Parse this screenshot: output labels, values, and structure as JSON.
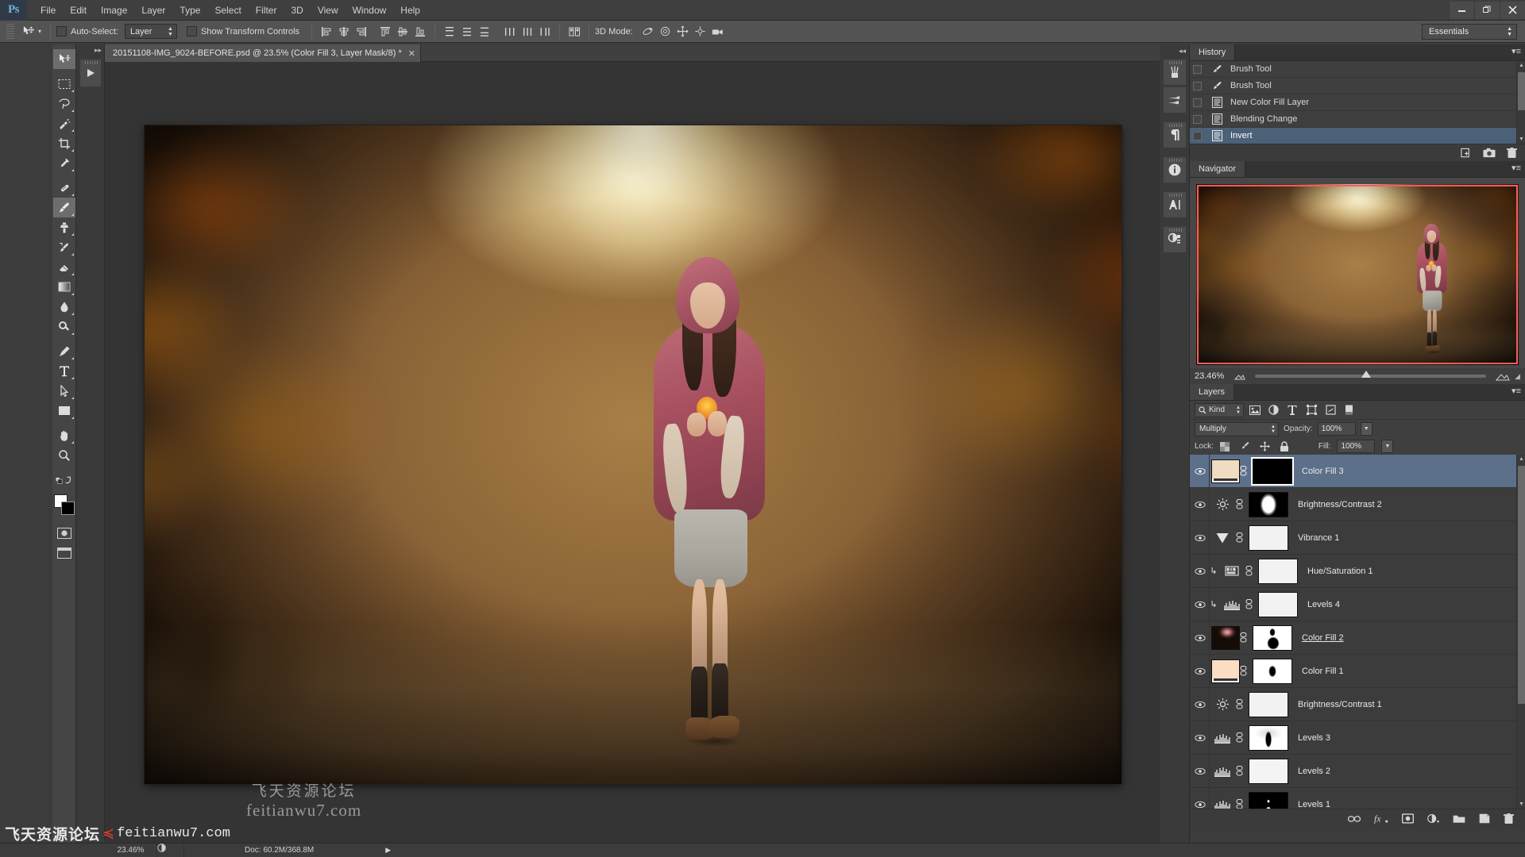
{
  "app": {
    "logo": "Ps"
  },
  "menubar": {
    "items": [
      "File",
      "Edit",
      "Image",
      "Layer",
      "Type",
      "Select",
      "Filter",
      "3D",
      "View",
      "Window",
      "Help"
    ],
    "window_controls": {
      "minimize": "—",
      "restore": "❐",
      "close": "✕"
    }
  },
  "options_bar": {
    "auto_select_label": "Auto-Select:",
    "auto_select_value": "Layer",
    "show_transform_label": "Show Transform Controls",
    "mode_3d_label": "3D Mode:",
    "workspace": "Essentials"
  },
  "toolbar": {
    "tools": [
      {
        "name": "move-tool",
        "glyph": "move",
        "active": false
      },
      {
        "name": "rectangular-marquee-tool",
        "glyph": "marquee",
        "active": false
      },
      {
        "name": "lasso-tool",
        "glyph": "lasso",
        "active": false
      },
      {
        "name": "quick-selection-tool",
        "glyph": "quickselect",
        "active": false
      },
      {
        "name": "crop-tool",
        "glyph": "crop",
        "active": false
      },
      {
        "name": "eyedropper-tool",
        "glyph": "eyedropper",
        "active": false
      },
      {
        "name": "spot-healing-brush-tool",
        "glyph": "healing",
        "active": false
      },
      {
        "name": "brush-tool",
        "glyph": "brush",
        "active": true
      },
      {
        "name": "clone-stamp-tool",
        "glyph": "stamp",
        "active": false
      },
      {
        "name": "history-brush-tool",
        "glyph": "historybrush",
        "active": false
      },
      {
        "name": "eraser-tool",
        "glyph": "eraser",
        "active": false
      },
      {
        "name": "gradient-tool",
        "glyph": "gradient",
        "active": false
      },
      {
        "name": "blur-tool",
        "glyph": "blur",
        "active": false
      },
      {
        "name": "dodge-tool",
        "glyph": "dodge",
        "active": false
      },
      {
        "name": "pen-tool",
        "glyph": "pen",
        "active": false
      },
      {
        "name": "horizontal-type-tool",
        "glyph": "type",
        "active": false
      },
      {
        "name": "path-selection-tool",
        "glyph": "pathselect",
        "active": false
      },
      {
        "name": "rectangle-tool",
        "glyph": "shape",
        "active": false
      },
      {
        "name": "hand-tool",
        "glyph": "hand",
        "active": false
      },
      {
        "name": "zoom-tool",
        "glyph": "zoom",
        "active": false
      }
    ],
    "foreground_color": "#ffffff",
    "background_color": "#000000"
  },
  "document": {
    "tab_title": "20151108-IMG_9024-BEFORE.psd @ 23.5% (Color Fill 3, Layer Mask/8) *",
    "close_glyph": "✕"
  },
  "canvas_watermark": {
    "cn": "飞天资源论坛",
    "en": "feitianwu7.com"
  },
  "history_panel": {
    "tab": "History",
    "items": [
      {
        "label": "Brush Tool",
        "icon": "brush-icon",
        "selected": false
      },
      {
        "label": "Brush Tool",
        "icon": "brush-icon",
        "selected": false
      },
      {
        "label": "New Color Fill Layer",
        "icon": "layer-icon",
        "selected": false
      },
      {
        "label": "Blending Change",
        "icon": "layer-icon",
        "selected": false
      },
      {
        "label": "Invert",
        "icon": "layer-icon",
        "selected": true
      }
    ],
    "footer_icons": [
      "new-document-from-state-icon",
      "new-snapshot-icon",
      "delete-icon"
    ]
  },
  "navigator_panel": {
    "tab": "Navigator",
    "zoom_value": "23.46%",
    "zoom_out_icon": "small-mountain-icon",
    "zoom_in_icon": "large-mountain-icon",
    "view_box_color": "#ff5b5b"
  },
  "layers_panel": {
    "tab": "Layers",
    "filter_kind_label": "Kind",
    "filter_icons": [
      "pixel-filter-icon",
      "adjustment-filter-icon",
      "type-filter-icon",
      "shape-filter-icon",
      "smart-object-filter-icon",
      "filter-toggle-icon"
    ],
    "blend_mode": "Multiply",
    "opacity_label": "Opacity:",
    "opacity_value": "100%",
    "lock_label": "Lock:",
    "lock_icons": [
      "lock-transparent-pixels-icon",
      "lock-image-pixels-icon",
      "lock-position-icon",
      "lock-all-icon"
    ],
    "fill_label": "Fill:",
    "fill_value": "100%",
    "layers": [
      {
        "name": "Color Fill 3",
        "type": "fill",
        "selected": true,
        "clipped": false,
        "underlined": false,
        "thumb": "solid-tan",
        "mask": "black",
        "mask_active": true
      },
      {
        "name": "Brightness/Contrast 2",
        "type": "adjustment",
        "icon": "brightness-contrast-icon",
        "selected": false,
        "clipped": false,
        "underlined": false,
        "mask": "black-with-white-oval"
      },
      {
        "name": "Vibrance 1",
        "type": "adjustment",
        "icon": "vibrance-icon",
        "selected": false,
        "clipped": false,
        "underlined": false,
        "mask": "white"
      },
      {
        "name": "Hue/Saturation 1",
        "type": "adjustment",
        "icon": "hue-saturation-icon",
        "selected": false,
        "clipped": true,
        "underlined": false,
        "mask": "white"
      },
      {
        "name": "Levels 4",
        "type": "adjustment",
        "icon": "levels-icon",
        "selected": false,
        "clipped": true,
        "underlined": false,
        "mask": "white"
      },
      {
        "name": "Color Fill 2 ",
        "type": "fill",
        "selected": false,
        "clipped": false,
        "underlined": true,
        "thumb": "dark-glow",
        "mask": "white-with-black-figure"
      },
      {
        "name": "Color Fill 1",
        "type": "fill",
        "selected": false,
        "clipped": false,
        "underlined": false,
        "thumb": "solid-peach",
        "mask": "white-with-black-blob"
      },
      {
        "name": "Brightness/Contrast 1",
        "type": "adjustment",
        "icon": "brightness-contrast-icon",
        "selected": false,
        "clipped": false,
        "underlined": false,
        "mask": "white"
      },
      {
        "name": "Levels 3",
        "type": "adjustment",
        "icon": "levels-icon",
        "selected": false,
        "clipped": false,
        "underlined": false,
        "mask": "white-with-black-figure"
      },
      {
        "name": "Levels 2",
        "type": "adjustment",
        "icon": "levels-icon",
        "selected": false,
        "clipped": false,
        "underlined": false,
        "mask": "white"
      },
      {
        "name": "Levels 1",
        "type": "adjustment",
        "icon": "levels-icon",
        "selected": false,
        "clipped": false,
        "underlined": false,
        "mask": "black-speckle"
      }
    ],
    "footer_icons": [
      "link-layers-icon",
      "layer-style-icon",
      "layer-mask-icon",
      "new-adjustment-layer-icon",
      "new-group-icon",
      "new-layer-icon",
      "delete-layer-icon"
    ]
  },
  "right_dock_icons": [
    "brush-presets-icon",
    "brush-settings-icon",
    "paragraph-icon",
    "info-icon",
    "character-styles-icon",
    "adjustments-icon"
  ],
  "status_bar": {
    "zoom": "23.46%",
    "doc_info": "Doc: 60.2M/368.8M",
    "arrow_glyph": "▶"
  },
  "bottom_watermark": {
    "cn": "飞天资源论坛",
    "en": "feitianwu7.com"
  }
}
